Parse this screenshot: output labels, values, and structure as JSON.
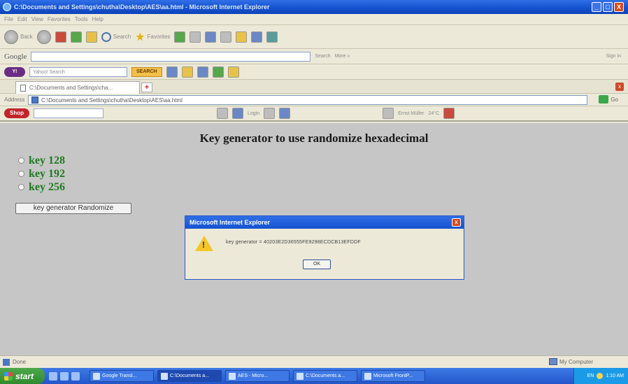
{
  "window": {
    "title": "C:\\Documents and Settings\\chutha\\Desktop\\AES\\aa.html - Microsoft Internet Explorer",
    "controls": [
      "_",
      "□",
      "X"
    ]
  },
  "menu": [
    "File",
    "Edit",
    "View",
    "Favorites",
    "Tools",
    "Help"
  ],
  "nav": {
    "back": "Back",
    "search": "Search",
    "favorites": "Favorites"
  },
  "google_bar": {
    "brand": "Google",
    "search_label": "Search",
    "more": "More »",
    "signin": "Sign in"
  },
  "yahoo_bar": {
    "logo": "Y!",
    "search_placeholder": "Yahoo! Search",
    "search_button": "SEARCH"
  },
  "tab": {
    "label": "C:\\Documents and Settings\\cha..."
  },
  "address": {
    "label": "Address",
    "url": "C:\\Documents and Settings\\chutha\\Desktop\\AES\\aa.html",
    "go": "Go"
  },
  "links_bar": {
    "logo": "Shop",
    "login": "Login",
    "user": "Ernst Müller",
    "weather": "24°C"
  },
  "page": {
    "heading": "Key generator to use randomize hexadecimal",
    "options": [
      "key 128",
      "key 192",
      "key 256"
    ],
    "button": "key generator Randomize"
  },
  "dialog": {
    "title": "Microsoft Internet Explorer",
    "message": "key generator = 40203E2D36555FE9298ECDCB13EFDDF",
    "ok": "OK"
  },
  "status": {
    "left": "Done",
    "right": "My Computer"
  },
  "taskbar": {
    "start": "start",
    "tasks": [
      "Google Transl...",
      "C:\\Documents a...",
      "AES - Micro...",
      "C:\\Documents a...",
      "Microsoft FrontP..."
    ],
    "tray_lang": "EN",
    "clock": "1:10 AM"
  }
}
